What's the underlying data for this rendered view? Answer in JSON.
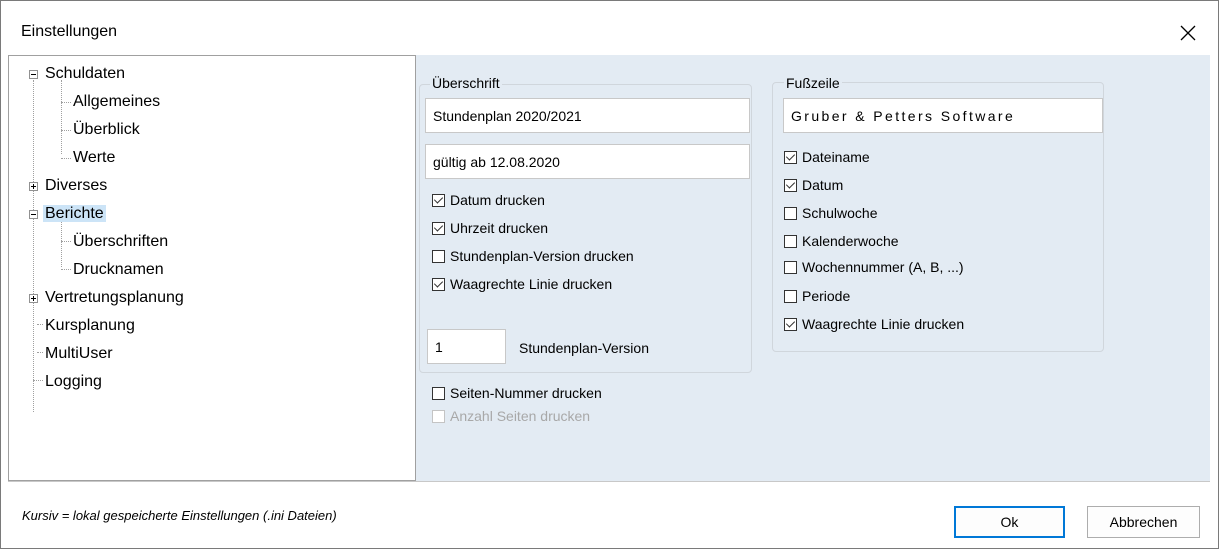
{
  "window": {
    "title": "Einstellungen",
    "close_icon": "close-icon"
  },
  "tree": {
    "schuldaten": "Schuldaten",
    "allgemeines": "Allgemeines",
    "ueberblick": "Überblick",
    "werte": "Werte",
    "diverses": "Diverses",
    "berichte": "Berichte",
    "ueberschriften": "Überschriften",
    "drucknamen": "Drucknamen",
    "vertretungsplanung": "Vertretungsplanung",
    "kursplanung": "Kursplanung",
    "multiuser": "MultiUser",
    "logging": "Logging",
    "selected": "Berichte"
  },
  "header_group": {
    "title": "Überschrift",
    "line1": "Stundenplan 2020/2021",
    "line2": "gültig ab 12.08.2020",
    "datum": {
      "label": "Datum drucken",
      "checked": true
    },
    "uhrzeit": {
      "label": "Uhrzeit drucken",
      "checked": true
    },
    "version": {
      "label": "Stundenplan-Version drucken",
      "checked": false
    },
    "linie": {
      "label": "Waagrechte Linie drucken",
      "checked": true
    },
    "version_value": "1",
    "version_label": "Stundenplan-Version"
  },
  "page_number": {
    "label": "Seiten-Nummer drucken",
    "checked": false
  },
  "page_count": {
    "label": "Anzahl Seiten drucken",
    "checked": false,
    "disabled": true
  },
  "footer_group": {
    "title": "Fußzeile",
    "text": "Gruber & Petters Software",
    "dateiname": {
      "label": "Dateiname",
      "checked": true
    },
    "datum": {
      "label": "Datum",
      "checked": true
    },
    "schulwoche": {
      "label": "Schulwoche",
      "checked": false
    },
    "kalenderwoche": {
      "label": "Kalenderwoche",
      "checked": false
    },
    "wochennummer": {
      "label": "Wochennummer (A, B, ...)",
      "checked": false
    },
    "periode": {
      "label": "Periode",
      "checked": false
    },
    "linie": {
      "label": "Waagrechte Linie drucken",
      "checked": true
    }
  },
  "footer": {
    "note": "Kursiv = lokal gespeicherte Einstellungen (.ini Dateien)",
    "ok": "Ok",
    "cancel": "Abbrechen"
  }
}
